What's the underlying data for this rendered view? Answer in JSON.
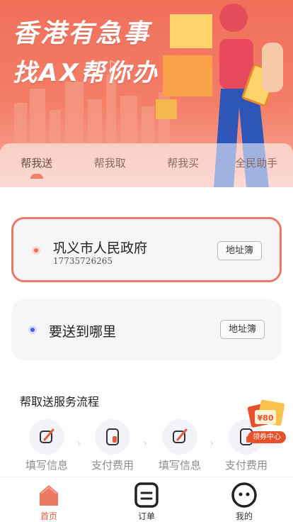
{
  "banner": {
    "line1": "香港有急事",
    "line2": "找AX帮你办",
    "brand_color": "#f0705a"
  },
  "tabs": [
    {
      "label": "帮我送",
      "active": true
    },
    {
      "label": "帮我取",
      "active": false
    },
    {
      "label": "帮我买",
      "active": false
    },
    {
      "label": "全民助手",
      "active": false
    }
  ],
  "sender": {
    "name": "巩义市人民政府",
    "phone": "17735726265",
    "address_book_label": "地址簿"
  },
  "receiver": {
    "placeholder": "要送到哪里",
    "address_book_label": "地址簿"
  },
  "flow": {
    "title": "帮取送服务流程",
    "steps": [
      {
        "label": "填写信息",
        "icon": "edit-icon"
      },
      {
        "label": "支付费用",
        "icon": "pay-icon"
      },
      {
        "label": "填写信息",
        "icon": "edit-icon"
      },
      {
        "label": "支付费用",
        "icon": "pay-icon"
      }
    ],
    "arrow": "›"
  },
  "coupon": {
    "amount": "¥80",
    "label": "领券中心"
  },
  "bottom_nav": [
    {
      "label": "首页",
      "icon": "home-icon",
      "active": true
    },
    {
      "label": "订单",
      "icon": "order-icon",
      "active": false
    },
    {
      "label": "我的",
      "icon": "profile-icon",
      "active": false
    }
  ]
}
